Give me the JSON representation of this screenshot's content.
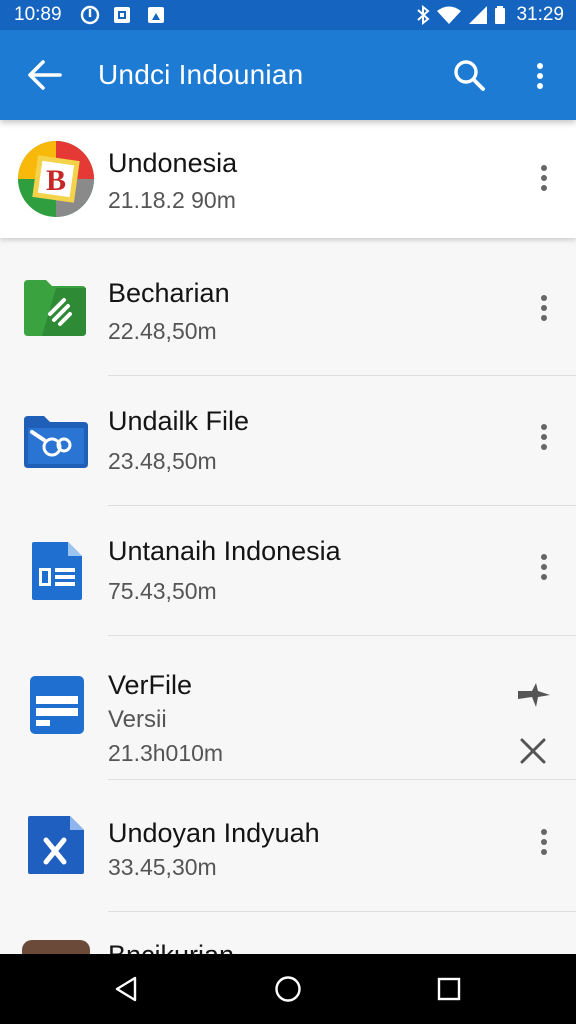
{
  "status_bar": {
    "time": "10:89",
    "clock": "31:29",
    "icons": [
      "do-not-disturb-icon",
      "notification-icon",
      "image-icon",
      "bluetooth-icon",
      "wifi-icon",
      "signal-icon",
      "battery-icon"
    ]
  },
  "app_bar": {
    "title": "Undci Indounian",
    "icons": [
      "back-arrow-icon",
      "search-icon",
      "more-vert-icon"
    ],
    "color": "#1e7bd4"
  },
  "list": {
    "items": [
      {
        "title": "Undonesia",
        "size": "21.18.2 90m",
        "icon": "brand-logo-icon",
        "badge_letter": "B",
        "action": "more-vert-icon"
      },
      {
        "title": "Becharian",
        "size": "22.48,50m",
        "icon": "green-folder-icon",
        "action": "more-vert-icon"
      },
      {
        "title": "Undailk File",
        "size": "23.48,50m",
        "icon": "blue-folder-icon",
        "action": "more-vert-icon"
      },
      {
        "title": "Untanaih Indonesia",
        "size": "75.43,50m",
        "icon": "doc-file-icon",
        "action": "more-vert-icon"
      },
      {
        "title": "VerFile",
        "subtitle": "Versii",
        "size": "21.3h010m",
        "icon": "form-file-icon",
        "actions": [
          "pin-icon",
          "close-icon"
        ]
      },
      {
        "title": "Undoyan Indyuah",
        "size": "33.45,30m",
        "icon": "excel-file-icon",
        "action": "more-vert-icon"
      },
      {
        "title": "Bncikurian",
        "icon": "avatar-photo-icon"
      }
    ]
  },
  "nav_bar": {
    "buttons": [
      "back-triangle-icon",
      "home-circle-icon",
      "recents-square-icon"
    ]
  }
}
